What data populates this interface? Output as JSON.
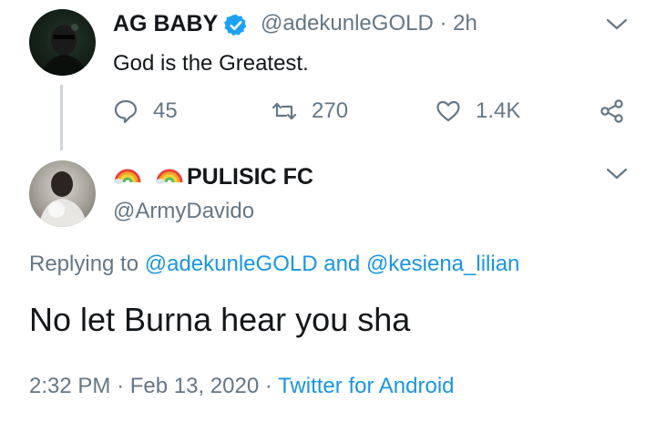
{
  "tweet": {
    "author_name": "AG BABY",
    "handle": "@adekunleGOLD",
    "separator": "·",
    "time": "2h",
    "text": "God is the Greatest.",
    "replies": "45",
    "retweets": "270",
    "likes": "1.4K"
  },
  "reply_tweet": {
    "author_name": "PULISIC FC",
    "handle": "@ArmyDavido",
    "replying_prefix": "Replying to",
    "replying_user1": "@adekunleGOLD",
    "replying_and": "and",
    "replying_user2": "@kesiena_lilian",
    "text": "No let Burna hear you sha",
    "time": "2:32 PM",
    "dot1": "·",
    "date": "Feb 13, 2020",
    "dot2": "·",
    "source": "Twitter for Android"
  },
  "colors": {
    "text": "#14171a",
    "muted": "#657786",
    "link": "#1b95e0",
    "verified": "#1da1f2"
  },
  "icons": [
    "verified-badge-icon",
    "chevron-down-icon",
    "reply-icon",
    "retweet-icon",
    "like-icon",
    "share-icon",
    "rainbow-emoji"
  ]
}
